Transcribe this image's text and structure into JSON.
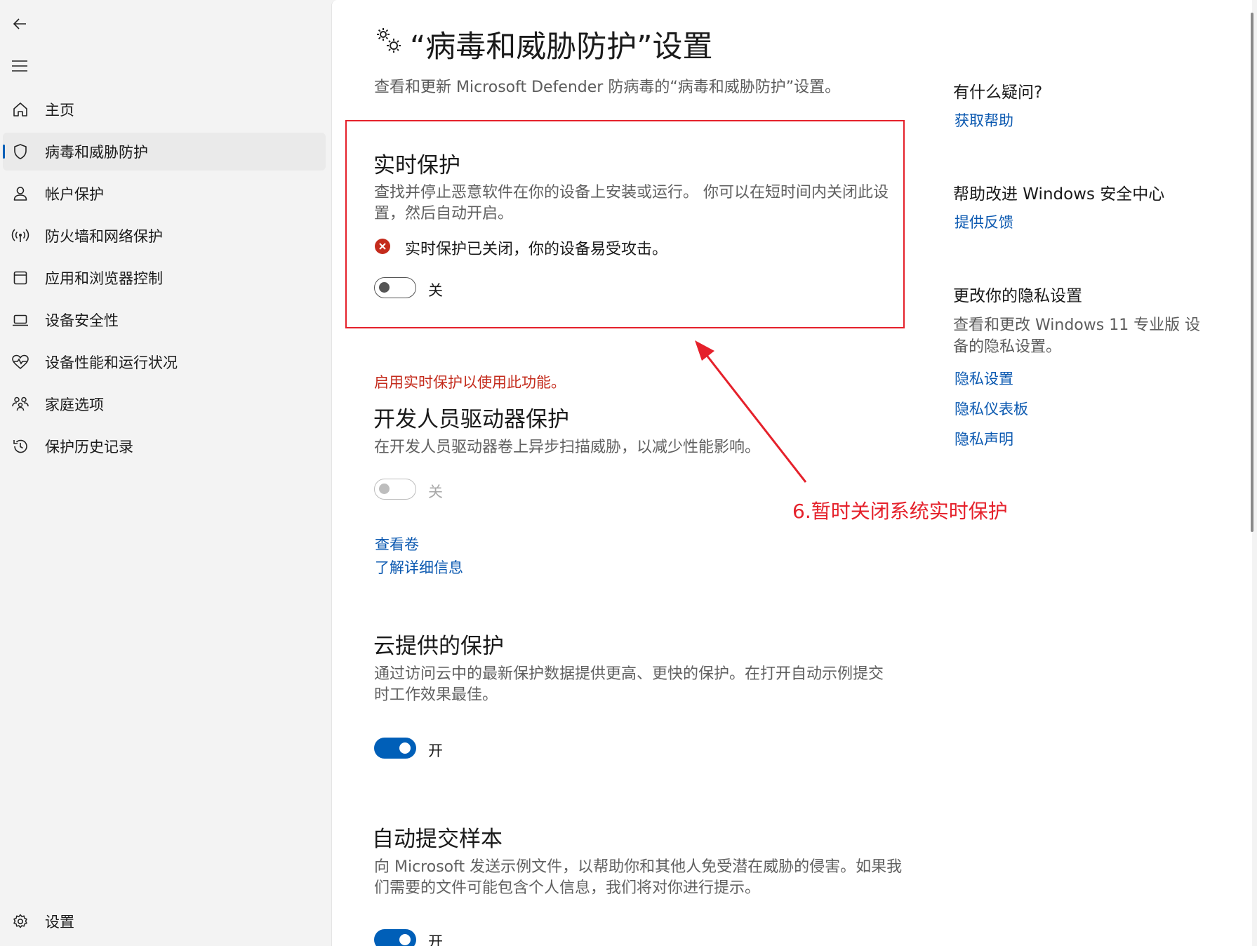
{
  "sidebar": {
    "back_icon": "back-arrow-icon",
    "menu_icon": "hamburger-menu-icon",
    "items": [
      {
        "label": "主页",
        "icon": "home-icon"
      },
      {
        "label": "病毒和威胁防护",
        "icon": "shield-icon",
        "active": true
      },
      {
        "label": "帐户保护",
        "icon": "person-icon"
      },
      {
        "label": "防火墙和网络保护",
        "icon": "wireless-icon"
      },
      {
        "label": "应用和浏览器控制",
        "icon": "browser-window-icon"
      },
      {
        "label": "设备安全性",
        "icon": "laptop-icon"
      },
      {
        "label": "设备性能和运行状况",
        "icon": "heart-pulse-icon"
      },
      {
        "label": "家庭选项",
        "icon": "family-icon"
      },
      {
        "label": "保护历史记录",
        "icon": "history-icon"
      }
    ],
    "settings": {
      "label": "设置",
      "icon": "gear-icon"
    }
  },
  "main": {
    "title": "“病毒和威胁防护”设置",
    "title_icon": "gears-icon",
    "subtitle": "查看和更新 Microsoft Defender 防病毒的“病毒和威胁防护”设置。",
    "realtime": {
      "title": "实时保护",
      "desc": "查找并停止恶意软件在你的设备上安装或运行。 你可以在短时间内关闭此设置，然后自动开启。",
      "status": "实时保护已关闭，你的设备易受攻击。",
      "status_icon": "error-x-icon",
      "toggle_label": "关",
      "toggle_state": "off"
    },
    "devdrive": {
      "warning": "启用实时保护以使用此功能。",
      "title": "开发人员驱动器保护",
      "desc": "在开发人员驱动器卷上异步扫描威胁，以减少性能影响。",
      "toggle_label": "关",
      "toggle_state": "disabled",
      "link_volumes": "查看卷",
      "link_learn": "了解详细信息"
    },
    "cloud": {
      "title": "云提供的保护",
      "desc": "通过访问云中的最新保护数据提供更高、更快的保护。在打开自动示例提交时工作效果最佳。",
      "toggle_label": "开",
      "toggle_state": "on"
    },
    "samples": {
      "title": "自动提交样本",
      "desc": "向 Microsoft 发送示例文件，以帮助你和其他人免受潜在威胁的侵害。如果我们需要的文件可能包含个人信息，我们将对你进行提示。",
      "toggle_label": "开",
      "toggle_state": "on"
    }
  },
  "right": {
    "questions_title": "有什么疑问?",
    "get_help": "获取帮助",
    "improve_title": "帮助改进 Windows 安全中心",
    "feedback": "提供反馈",
    "privacy_title": "更改你的隐私设置",
    "privacy_desc": "查看和更改 Windows 11 专业版 设备的隐私设置。",
    "privacy_settings": "隐私设置",
    "privacy_dashboard": "隐私仪表板",
    "privacy_statement": "隐私声明"
  },
  "annotation": {
    "text": "6.暂时关闭系统实时保护",
    "color": "#e5212b"
  },
  "colors": {
    "accent": "#005fb8",
    "link": "#0a58b0",
    "error": "#c42b1c"
  }
}
